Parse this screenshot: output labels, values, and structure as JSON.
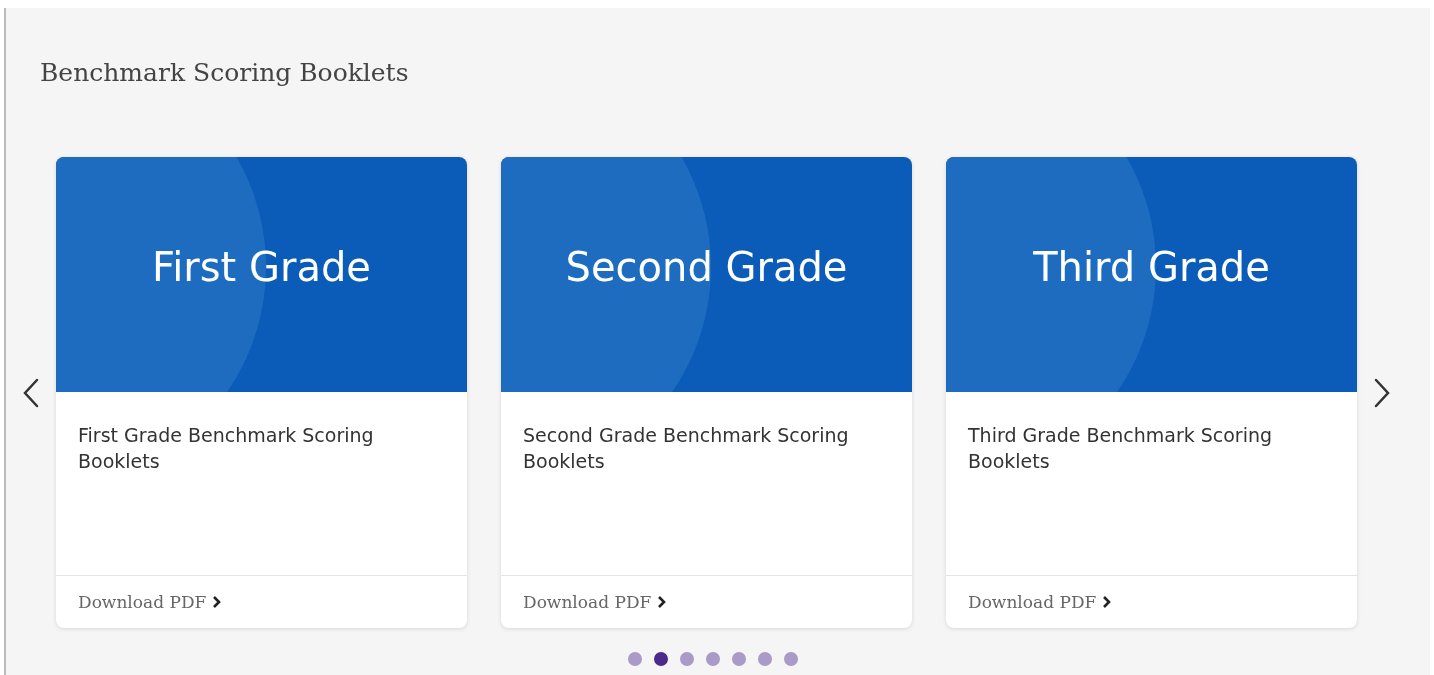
{
  "title": "Benchmark Scoring Booklets",
  "cards": [
    {
      "banner": "First Grade",
      "text": "First Grade Benchmark Scoring Booklets",
      "link": "Download PDF"
    },
    {
      "banner": "Second Grade",
      "text": "Second Grade Benchmark Scoring Booklets",
      "link": "Download PDF"
    },
    {
      "banner": "Third Grade",
      "text": "Third Grade Benchmark Scoring Booklets",
      "link": "Download PDF"
    }
  ],
  "dots": [
    {
      "selected": false
    },
    {
      "selected": true
    },
    {
      "selected": false
    },
    {
      "selected": false
    },
    {
      "selected": false
    },
    {
      "selected": false
    },
    {
      "selected": false
    }
  ]
}
